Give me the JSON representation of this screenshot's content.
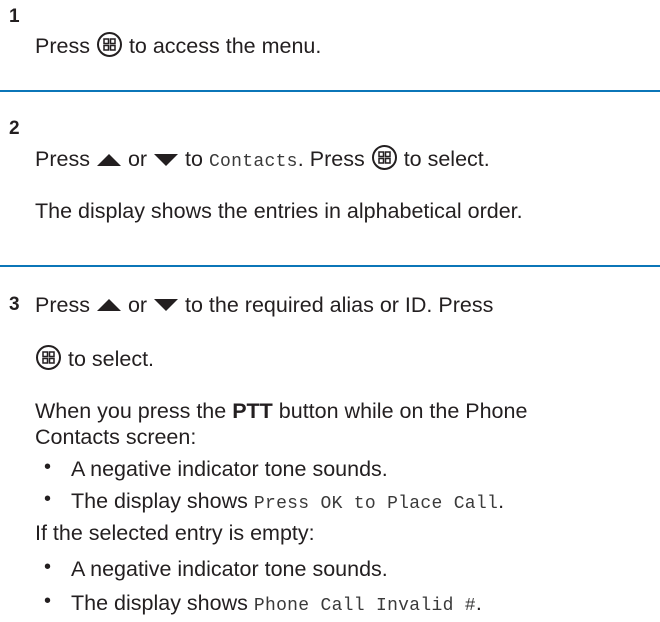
{
  "steps": [
    {
      "number": "1",
      "text": {
        "a": "Press",
        "b": "to access the menu."
      }
    },
    {
      "number": "2",
      "text": {
        "a": "Press",
        "or": "or",
        "to": "to",
        "menu": "Contacts",
        "dot": ".",
        "press2": "Press",
        "select": "to select."
      },
      "note": "The display shows the entries in alphabetical order."
    },
    {
      "number": "3",
      "line1": {
        "a": "Press",
        "or": "or",
        "rest": "to the required alias or ID. Press"
      },
      "line2": "to select.",
      "ptt": {
        "pre": "When you press the",
        "btn": "PTT",
        "post": "button while on the Phone",
        "line2": "Contacts screen:"
      },
      "ptt_bullets": [
        "A negative indicator tone sounds.",
        {
          "pre": "The display shows",
          "mono": "Press OK to Place Call",
          "post": "."
        }
      ],
      "empty": "If the selected entry is empty:",
      "empty_bullets": [
        "A negative indicator tone sounds.",
        {
          "pre": "The display shows",
          "mono": "Phone Call Invalid #",
          "post": "."
        }
      ]
    }
  ],
  "icons": {
    "menu_ok": "menu-ok-button-icon",
    "up": "up-arrow-icon",
    "down": "down-arrow-icon"
  },
  "colors": {
    "rule": "#0b76b8",
    "text": "#231f20"
  }
}
